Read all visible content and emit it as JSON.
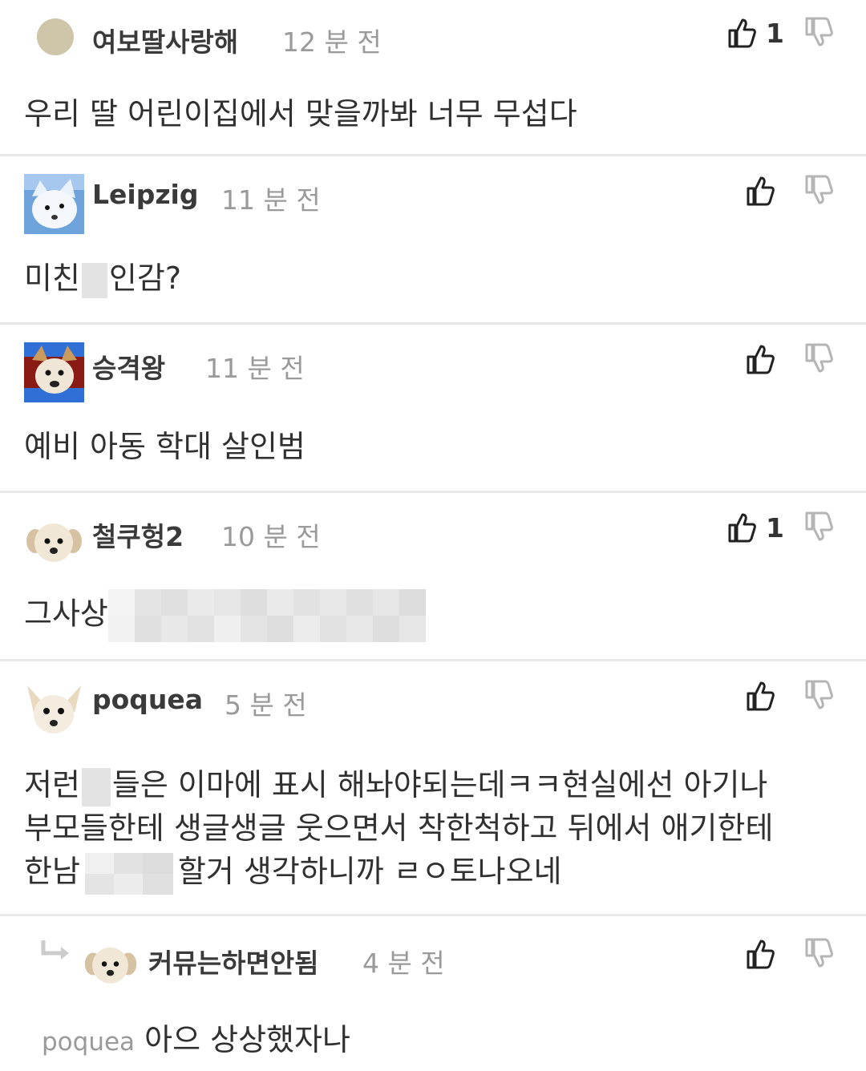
{
  "comments": [
    {
      "nickname": "여보딸사랑해",
      "time": "12 분 전",
      "likes": "1",
      "text": "우리 딸 어린이집에서 맞을까봐 너무 무섭다",
      "avatar": "tan-circle"
    },
    {
      "nickname": "Leipzig",
      "time": "11 분 전",
      "likes": "",
      "text_before": "미친",
      "text_after": "인감?",
      "avatar": "white-fox-icon"
    },
    {
      "nickname": "승격왕",
      "time": "11 분 전",
      "likes": "",
      "text": "예비 아동 학대 살인범",
      "avatar": "dog-on-red-icon"
    },
    {
      "nickname": "철쿠헝2",
      "time": "10 분 전",
      "likes": "1",
      "text_before": "그사상",
      "avatar": "puppy-icon"
    },
    {
      "nickname": "poquea",
      "time": "5 분 전",
      "likes": "",
      "line1_before": "저런",
      "line1_after": "들은 이마에 표시 해놔야되는데ㅋㅋ현실에선 아기나",
      "line2": "부모들한테 생글생글 웃으면서 착한척하고 뒤에서 애기한테",
      "line3_before": "한남",
      "line3_after": "할거 생각하니까 ㄹㅇ토나오네",
      "avatar": "chihuahua-icon"
    },
    {
      "nickname": "커뮤는하면안됨",
      "time": "4 분 전",
      "likes": "",
      "mention": "poquea",
      "text": "아으 상상했자나",
      "avatar": "puppy-icon",
      "is_reply": true
    }
  ],
  "colors": {
    "divider": "#e8e8e8",
    "time": "#9a9a9a",
    "icon": "#222222",
    "dislike_icon": "#b5b5b5",
    "censor": "#e3e3e3"
  },
  "icons": {
    "like": "thumbs-up-icon",
    "dislike": "thumbs-down-icon",
    "reply": "reply-arrow-icon"
  }
}
